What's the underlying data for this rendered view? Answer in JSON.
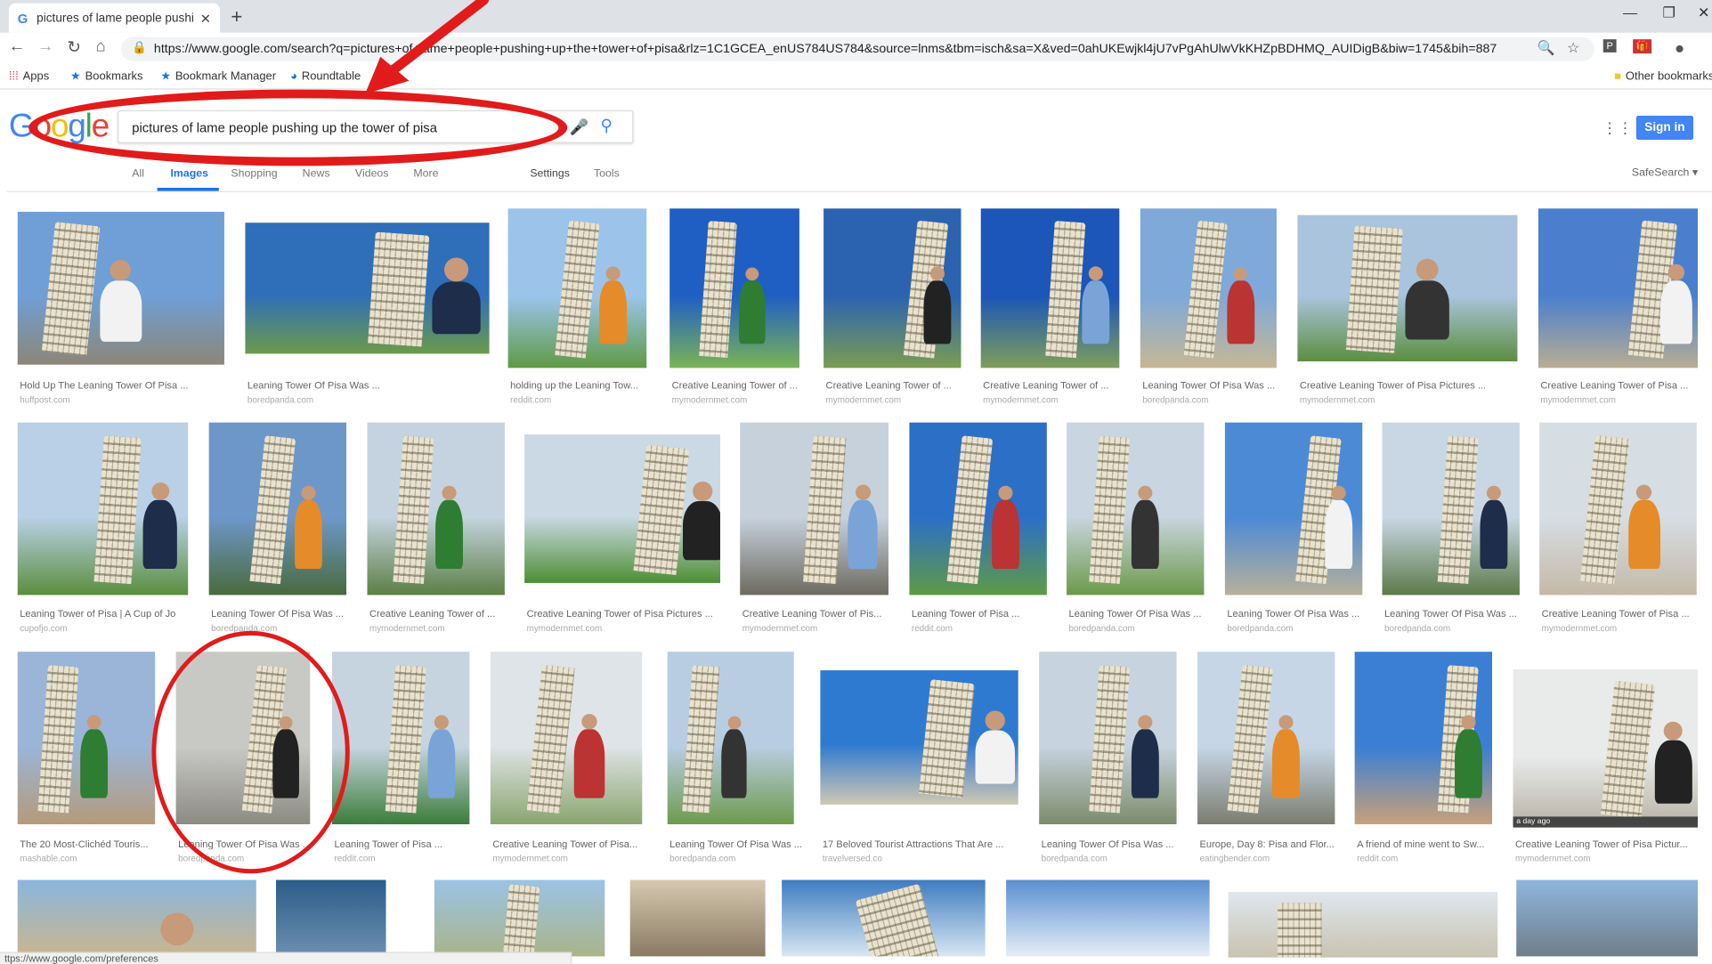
{
  "browser": {
    "tab_title": "pictures of lame people pushing",
    "tab_close_glyph": "✕",
    "new_tab_glyph": "+",
    "url": "https://www.google.com/search?q=pictures+of+lame+people+pushing+up+the+tower+of+pisa&rlz=1C1GCEA_enUS784US784&source=lnms&tbm=isch&sa=X&ved=0ahUKEwjkl4jU7vPgAhUlwVkKHZpBDHMQ_AUIDigB&biw=1745&bih=887",
    "bookmarks": [
      "Apps",
      "Bookmarks",
      "Bookmark Manager",
      "Roundtable"
    ],
    "other_bookmarks": "Other bookmarks",
    "status_url": "ttps://www.google.com/preferences"
  },
  "google": {
    "query": "pictures of lame people pushing up the tower of pisa",
    "sign_in": "Sign in",
    "tabs": [
      "All",
      "Images",
      "Shopping",
      "News",
      "Videos",
      "More"
    ],
    "settings": "Settings",
    "tools": "Tools",
    "safesearch": "SafeSearch ▾"
  },
  "colors": {
    "annotation": "#e11b1b",
    "google_blue": "#4285f4"
  },
  "results": [
    {
      "caption": "Hold Up The Leaning Tower Of Pisa ...",
      "source": "huffpost.com"
    },
    {
      "caption": "Leaning Tower Of Pisa Was ...",
      "source": "boredpanda.com"
    },
    {
      "caption": "holding up the Leaning Tow...",
      "source": "reddit.com"
    },
    {
      "caption": "Creative Leaning Tower of ...",
      "source": "mymodernmet.com"
    },
    {
      "caption": "Creative Leaning Tower of ...",
      "source": "mymodernmet.com"
    },
    {
      "caption": "Creative Leaning Tower of ...",
      "source": "mymodernmet.com"
    },
    {
      "caption": "Leaning Tower Of Pisa Was ...",
      "source": "boredpanda.com"
    },
    {
      "caption": "Creative Leaning Tower of Pisa Pictures ...",
      "source": "mymodernmet.com"
    },
    {
      "caption": "Creative Leaning Tower of Pisa ...",
      "source": "mymodernmet.com"
    },
    {
      "caption": "Leaning Tower of Pisa | A Cup of Jo",
      "source": "cupofjo.com"
    },
    {
      "caption": "Leaning Tower Of Pisa Was ...",
      "source": "boredpanda.com"
    },
    {
      "caption": "Creative Leaning Tower of ...",
      "source": "mymodernmet.com"
    },
    {
      "caption": "Creative Leaning Tower of Pisa Pictures ...",
      "source": "mymodernmet.com"
    },
    {
      "caption": "Creative Leaning Tower of Pis...",
      "source": "mymodernmet.com"
    },
    {
      "caption": "Leaning Tower of Pisa ...",
      "source": "reddit.com"
    },
    {
      "caption": "Leaning Tower Of Pisa Was ...",
      "source": "boredpanda.com"
    },
    {
      "caption": "Leaning Tower Of Pisa Was ...",
      "source": "boredpanda.com"
    },
    {
      "caption": "Leaning Tower Of Pisa Was ...",
      "source": "boredpanda.com"
    },
    {
      "caption": "Creative Leaning Tower of Pisa ...",
      "source": "mymodernmet.com"
    },
    {
      "caption": "The 20 Most-Clichéd Touris...",
      "source": "mashable.com"
    },
    {
      "caption": "Leaning Tower Of Pisa Was ...",
      "source": "boredpanda.com"
    },
    {
      "caption": "Leaning Tower of Pisa ...",
      "source": "reddit.com"
    },
    {
      "caption": "Creative Leaning Tower of Pisa...",
      "source": "mymodernmet.com"
    },
    {
      "caption": "Leaning Tower Of Pisa Was ...",
      "source": "boredpanda.com"
    },
    {
      "caption": "17 Beloved Tourist Attractions That Are ...",
      "source": "travelversed.co"
    },
    {
      "caption": "Leaning Tower Of Pisa Was ...",
      "source": "boredpanda.com"
    },
    {
      "caption": "Europe, Day 8: Pisa and Flor...",
      "source": "eatingbender.com"
    },
    {
      "caption": "A friend of mine went to Sw...",
      "source": "reddit.com"
    },
    {
      "caption": "Creative Leaning Tower of Pisa Pictur...",
      "source": "mymodernmet.com",
      "badge": "a day ago"
    }
  ]
}
